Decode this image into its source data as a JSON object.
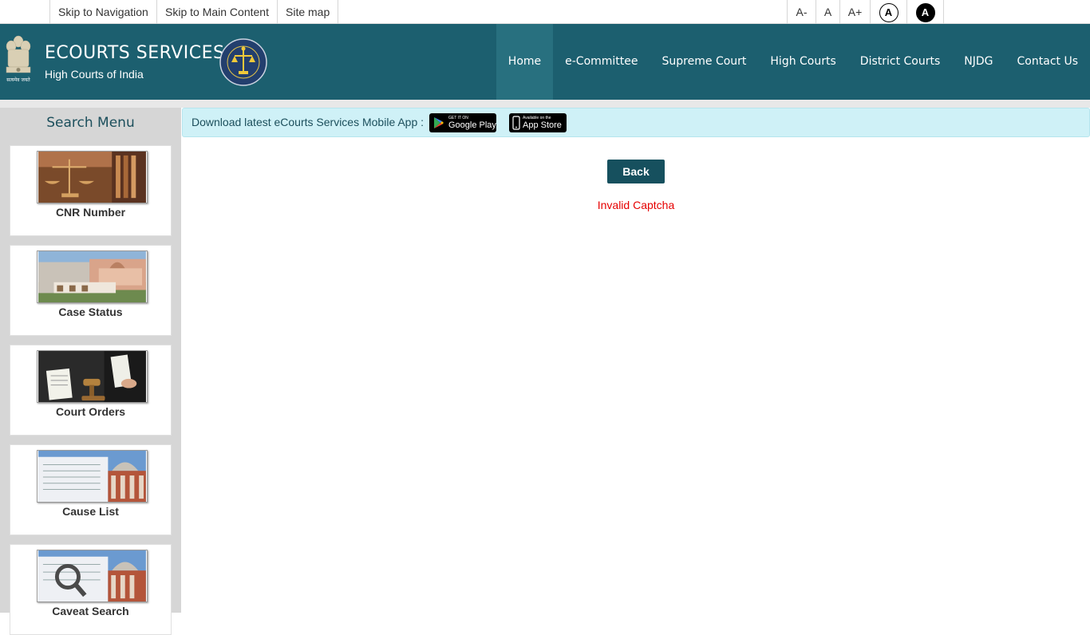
{
  "topbar": {
    "skip_nav": "Skip to Navigation",
    "skip_main": "Skip to Main Content",
    "sitemap": "Site map",
    "font_decrease": "A-",
    "font_normal": "A",
    "font_increase": "A+",
    "contrast_normal": "A",
    "contrast_high": "A"
  },
  "header": {
    "title": "ECOURTS SERVICES",
    "subtitle": "High Courts of India",
    "emblem_caption": "सत्यमेव जयते",
    "nav": [
      "Home",
      "e-Committee",
      "Supreme Court",
      "High Courts",
      "District Courts",
      "NJDG",
      "Contact Us"
    ],
    "active_nav": "Home"
  },
  "sidebar": {
    "title": "Search Menu",
    "items": [
      {
        "label": "CNR Number",
        "icon": "scales-of-justice-image"
      },
      {
        "label": "Case Status",
        "icon": "supreme-court-building-image"
      },
      {
        "label": "Court Orders",
        "icon": "judge-gavel-document-image"
      },
      {
        "label": "Cause List",
        "icon": "cause-list-court-image"
      },
      {
        "label": "Caveat Search",
        "icon": "magnifier-court-image"
      }
    ]
  },
  "appbar": {
    "text": "Download latest eCourts Services Mobile App :",
    "google_small": "GET IT ON",
    "google_big": "Google Play",
    "apple_small": "Available on the",
    "apple_big": "App Store"
  },
  "main": {
    "back_label": "Back",
    "error_text": "Invalid Captcha"
  },
  "colors": {
    "header_bg": "#1c5f6f",
    "nav_active": "#28707f",
    "button_bg": "#16505e",
    "error": "#e60000",
    "appbar_bg": "#cff1f7",
    "sidebar_bg": "#d6d6d6"
  }
}
